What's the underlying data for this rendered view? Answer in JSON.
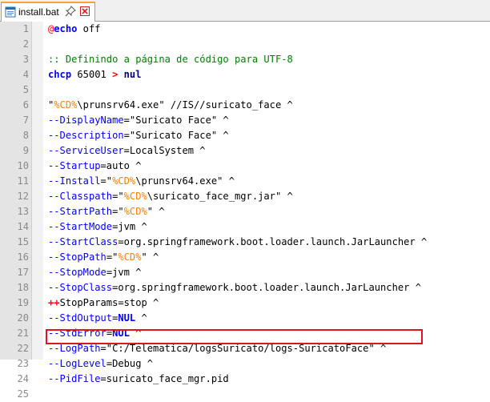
{
  "tab": {
    "filename": "install.bat",
    "icon": "file-icon",
    "pin_icon": "pin-icon",
    "close_icon": "close-icon"
  },
  "colors": {
    "highlight_box": "#e0141c",
    "comment": "#008000",
    "option": "#0000ff",
    "variable": "#ff8000"
  },
  "lines": [
    {
      "n": "1",
      "segs": [
        [
          "at",
          "@"
        ],
        [
          "kw",
          "echo"
        ],
        [
          "t",
          " off"
        ]
      ]
    },
    {
      "n": "2",
      "segs": []
    },
    {
      "n": "3",
      "segs": [
        [
          "cm",
          ":: Definindo a página de código para UTF-8"
        ]
      ]
    },
    {
      "n": "4",
      "segs": [
        [
          "kw",
          "chcp"
        ],
        [
          "t",
          " 65001 "
        ],
        [
          "op",
          ">"
        ],
        [
          "t",
          " "
        ],
        [
          "opn",
          "nul"
        ]
      ]
    },
    {
      "n": "5",
      "segs": []
    },
    {
      "n": "6",
      "segs": [
        [
          "t",
          "\""
        ],
        [
          "var",
          "%CD%"
        ],
        [
          "t",
          "\\prunsrv64.exe\" //IS//suricato_face ^"
        ]
      ]
    },
    {
      "n": "7",
      "segs": [
        [
          "dash",
          "--DisplayName"
        ],
        [
          "t",
          "=\"Suricato Face\" ^"
        ]
      ]
    },
    {
      "n": "8",
      "segs": [
        [
          "dash",
          "--Description"
        ],
        [
          "t",
          "=\"Suricato Face\" ^"
        ]
      ]
    },
    {
      "n": "9",
      "segs": [
        [
          "dash",
          "--ServiceUser"
        ],
        [
          "t",
          "=LocalSystem ^"
        ]
      ]
    },
    {
      "n": "10",
      "segs": [
        [
          "dash",
          "--Startup"
        ],
        [
          "t",
          "=auto ^"
        ]
      ]
    },
    {
      "n": "11",
      "segs": [
        [
          "dash",
          "--Install"
        ],
        [
          "t",
          "=\""
        ],
        [
          "var",
          "%CD%"
        ],
        [
          "t",
          "\\prunsrv64.exe\" ^"
        ]
      ]
    },
    {
      "n": "12",
      "segs": [
        [
          "dash",
          "--Classpath"
        ],
        [
          "t",
          "=\""
        ],
        [
          "var",
          "%CD%"
        ],
        [
          "t",
          "\\suricato_face_mgr.jar\" ^"
        ]
      ]
    },
    {
      "n": "13",
      "segs": [
        [
          "dash",
          "--StartPath"
        ],
        [
          "t",
          "=\""
        ],
        [
          "var",
          "%CD%"
        ],
        [
          "t",
          "\" ^"
        ]
      ]
    },
    {
      "n": "14",
      "segs": [
        [
          "dash",
          "--StartMode"
        ],
        [
          "t",
          "=jvm ^"
        ]
      ]
    },
    {
      "n": "15",
      "segs": [
        [
          "dash",
          "--StartClass"
        ],
        [
          "t",
          "=org.springframework.boot.loader.launch.JarLauncher ^"
        ]
      ]
    },
    {
      "n": "16",
      "segs": [
        [
          "dash",
          "--StopPath"
        ],
        [
          "t",
          "=\""
        ],
        [
          "var",
          "%CD%"
        ],
        [
          "t",
          "\" ^"
        ]
      ]
    },
    {
      "n": "17",
      "segs": [
        [
          "dash",
          "--StopMode"
        ],
        [
          "t",
          "=jvm ^"
        ]
      ]
    },
    {
      "n": "18",
      "segs": [
        [
          "dash",
          "--StopClass"
        ],
        [
          "t",
          "=org.springframework.boot.loader.launch.JarLauncher ^"
        ]
      ]
    },
    {
      "n": "19",
      "segs": [
        [
          "op",
          "++"
        ],
        [
          "t",
          "StopParams=stop ^"
        ]
      ]
    },
    {
      "n": "20",
      "segs": [
        [
          "dash",
          "--StdOutput"
        ],
        [
          "t",
          "="
        ],
        [
          "kw",
          "NUL"
        ],
        [
          "t",
          " ^"
        ]
      ]
    },
    {
      "n": "21",
      "segs": [
        [
          "dash",
          "--StdError"
        ],
        [
          "t",
          "="
        ],
        [
          "kw",
          "NUL"
        ],
        [
          "t",
          " ^"
        ]
      ]
    },
    {
      "n": "22",
      "segs": [
        [
          "dash",
          "--LogPath"
        ],
        [
          "t",
          "=\"C:/Telematica/logsSuricato/logs-SuricatoFace\" ^"
        ]
      ]
    },
    {
      "n": "23",
      "segs": [
        [
          "dash",
          "--LogLevel"
        ],
        [
          "t",
          "=Debug ^"
        ]
      ]
    },
    {
      "n": "24",
      "segs": [
        [
          "dash",
          "--PidFile"
        ],
        [
          "t",
          "=suricato_face_mgr.pid"
        ]
      ]
    },
    {
      "n": "25",
      "segs": []
    }
  ]
}
